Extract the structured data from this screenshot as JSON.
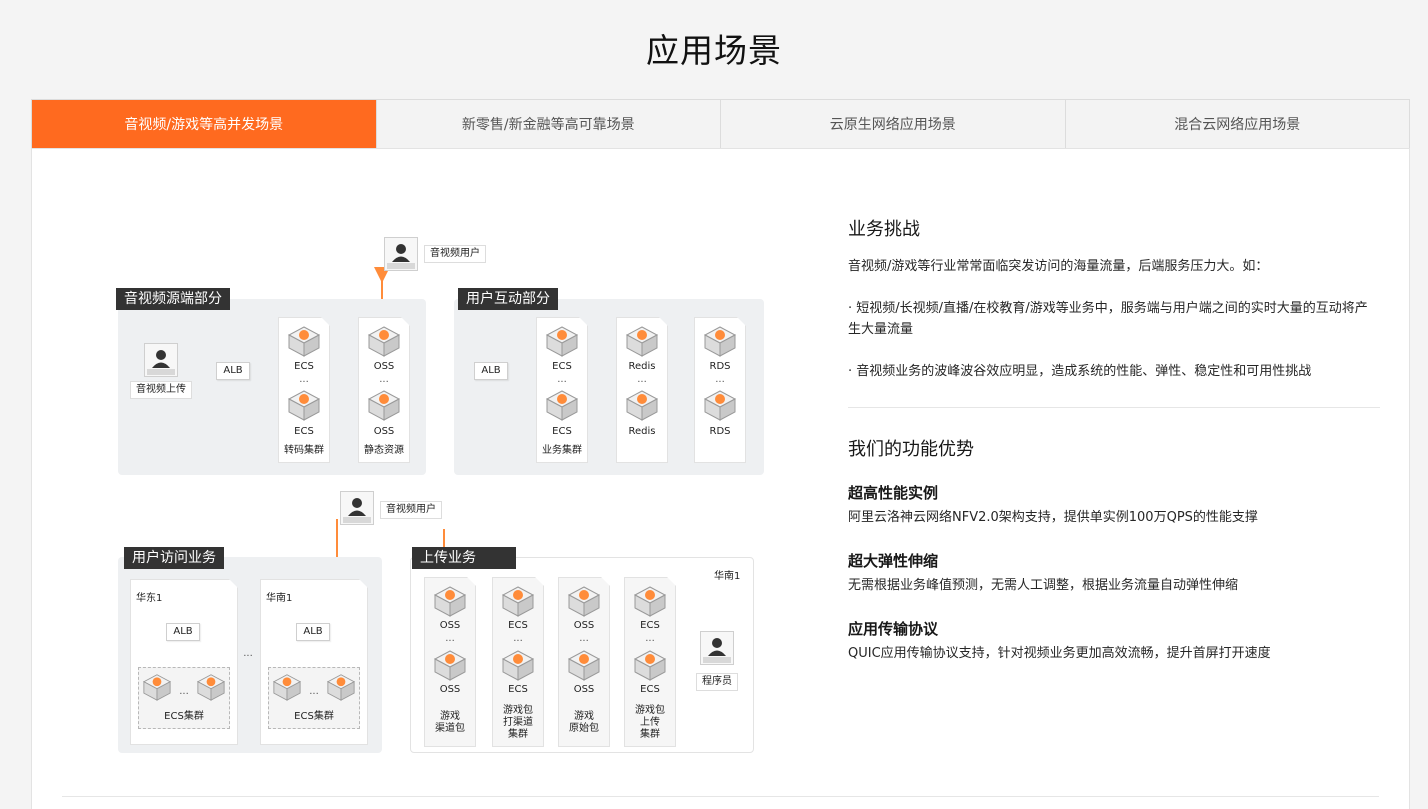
{
  "page": {
    "title": "应用场景"
  },
  "tabs": [
    {
      "label": "音视频/游戏等高并发场景"
    },
    {
      "label": "新零售/新金融等高可靠场景"
    },
    {
      "label": "云原生网络应用场景"
    },
    {
      "label": "混合云网络应用场景"
    }
  ],
  "diagram": {
    "top_user": "音视频用户",
    "group_source": "音视频源端部分",
    "group_interact": "用户互动部分",
    "upload_user": "音视频上传",
    "alb": "ALB",
    "ecs": "ECS",
    "oss": "OSS",
    "redis": "Redis",
    "rds": "RDS",
    "ellipsis": "...",
    "transcode_cluster": "转码集群",
    "static_resource": "静态资源",
    "biz_cluster": "业务集群",
    "mid_user": "音视频用户",
    "group_access": "用户访问业务",
    "group_upload": "上传业务",
    "region_east1": "华东1",
    "region_south1": "华南1",
    "region_south1_b": "华南1",
    "ecs_cluster": "ECS集群",
    "programmer": "程序员",
    "col_channel": "游戏\n渠道包",
    "col_pack": "游戏包\n打渠道\n集群",
    "col_origin": "游戏\n原始包",
    "col_upload": "游戏包\n上传\n集群",
    "colors": {
      "orange": "#ff8c3a",
      "gray_arrow": "#9a9a9a"
    }
  },
  "content": {
    "challenge_title": "业务挑战",
    "challenge_intro": "音视频/游戏等行业常常面临突发访问的海量流量，后端服务压力大。如：",
    "challenge_point1": "· 短视频/长视频/直播/在校教育/游戏等业务中，服务端与用户端之间的实时大量的互动将产生大量流量",
    "challenge_point2": "· 音视频业务的波峰波谷效应明显，造成系统的性能、弹性、稳定性和可用性挑战",
    "advantage_title": "我们的功能优势",
    "adv1_title": "超高性能实例",
    "adv1_desc": "阿里云洛神云网络NFV2.0架构支持，提供单实例100万QPS的性能支撑",
    "adv2_title": "超大弹性伸缩",
    "adv2_desc": "无需根据业务峰值预测，无需人工调整，根据业务流量自动弹性伸缩",
    "adv3_title": "应用传输协议",
    "adv3_desc": "QUIC应用传输协议支持，针对视频业务更加高效流畅，提升首屏打开速度"
  },
  "colors": {
    "accent": "#ff6a1f",
    "panel_bg": "#ffffff",
    "page_bg": "#f4f4f4"
  }
}
